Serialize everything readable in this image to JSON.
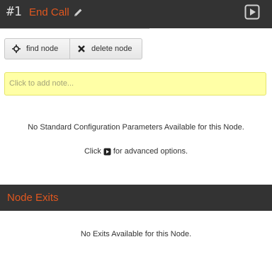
{
  "header": {
    "node_number": "#1",
    "node_title": "End Call",
    "edit_icon": "pencil-icon",
    "advanced_icon": "play-square-icon"
  },
  "toolbar": {
    "find_label": "find node",
    "find_icon": "crosshair-icon",
    "delete_label": "delete node",
    "delete_icon": "x-icon"
  },
  "note": {
    "placeholder": "Click to add note..."
  },
  "config": {
    "no_params": "No Standard Configuration Parameters Available for this Node.",
    "click_prefix": "Click",
    "click_suffix": "for advanced options."
  },
  "exits": {
    "title": "Node Exits",
    "empty": "No Exits Available for this Node."
  },
  "colors": {
    "header_bg": "#333333",
    "accent": "#e0571f",
    "note_bg": "#ffffa6"
  }
}
